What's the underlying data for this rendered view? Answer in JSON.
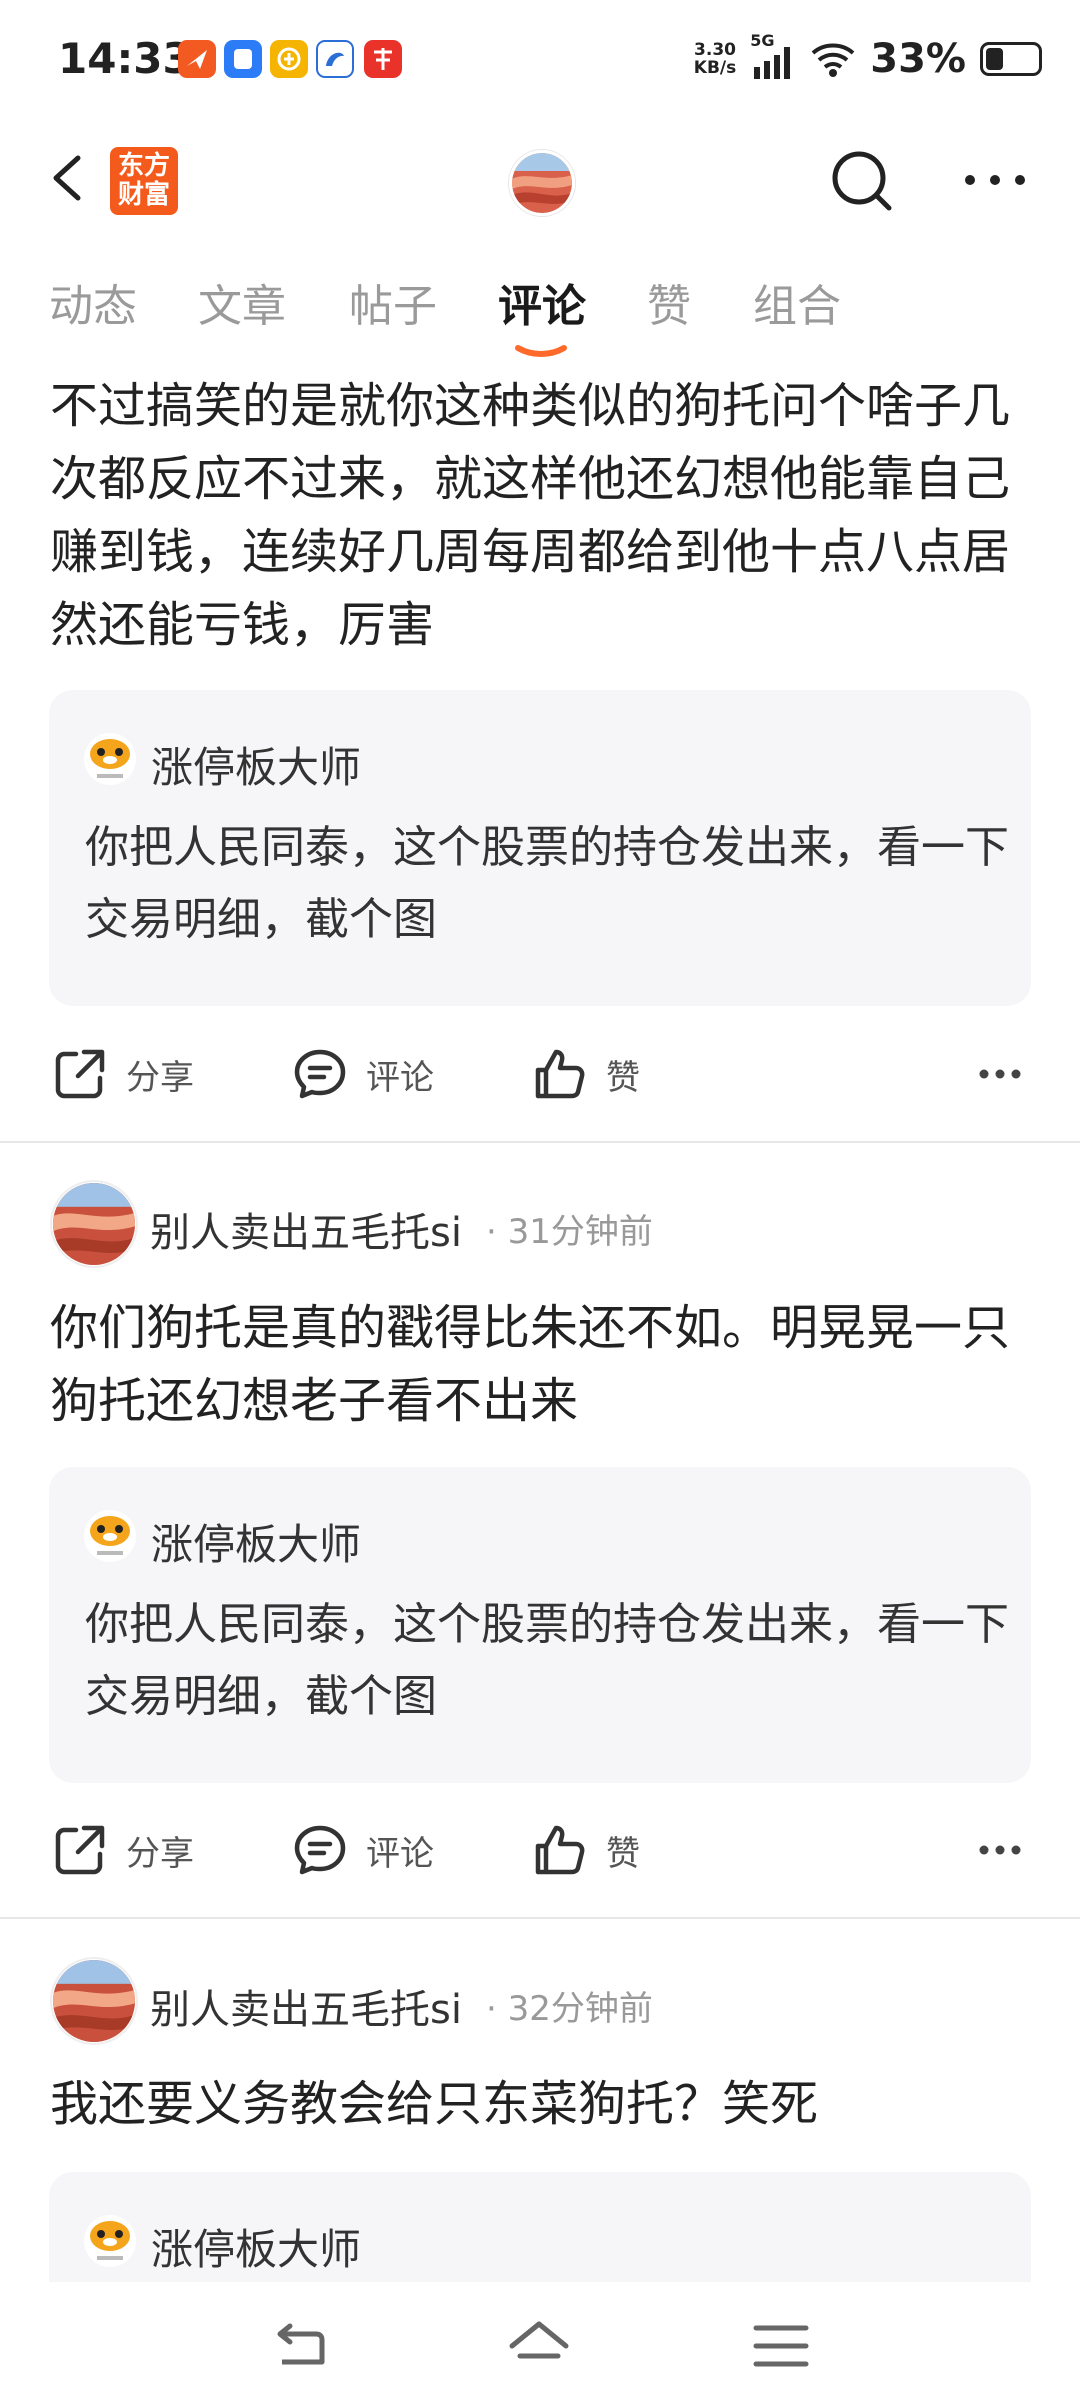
{
  "status": {
    "time": "14:33",
    "speed_value": "3.30",
    "speed_unit": "KB/s",
    "network": "5G",
    "battery": "33%",
    "battery_level": 0.33
  },
  "header": {
    "logo_line1": "东方",
    "logo_line2": "财富"
  },
  "tabs": [
    {
      "label": "动态",
      "active": false
    },
    {
      "label": "文章",
      "active": false
    },
    {
      "label": "帖子",
      "active": false
    },
    {
      "label": "评论",
      "active": true
    },
    {
      "label": "赞",
      "active": false
    },
    {
      "label": "组合",
      "active": false
    }
  ],
  "actions": {
    "share": "分享",
    "comment": "评论",
    "like": "赞"
  },
  "posts": [
    {
      "text": "不过搞笑的是就你这种类似的狗托问个啥子几次都反应不过来，就这样他还幻想他能靠自己赚到钱，连续好几周每周都给到他十点八点居然还能亏钱，厉害",
      "quote": {
        "author": "涨停板大师",
        "text": "你把人民同泰，这个股票的持仓发出来，看一下交易明细，截个图"
      }
    },
    {
      "user": "别人卖出五毛托si",
      "time": "31分钟前",
      "text": "你们狗托是真的戳得比朱还不如。明晃晃一只狗托还幻想老子看不出来",
      "quote": {
        "author": "涨停板大师",
        "text": "你把人民同泰，这个股票的持仓发出来，看一下交易明细，截个图"
      }
    },
    {
      "user": "别人卖出五毛托si",
      "time": "32分钟前",
      "text": "我还要义务教会给只东菜狗托？笑死",
      "quote": {
        "author": "涨停板大师"
      }
    }
  ],
  "colors": {
    "accent": "#f45a1c",
    "tab_underline": "#ff6a2b",
    "quote_bg": "#f6f6f8"
  }
}
